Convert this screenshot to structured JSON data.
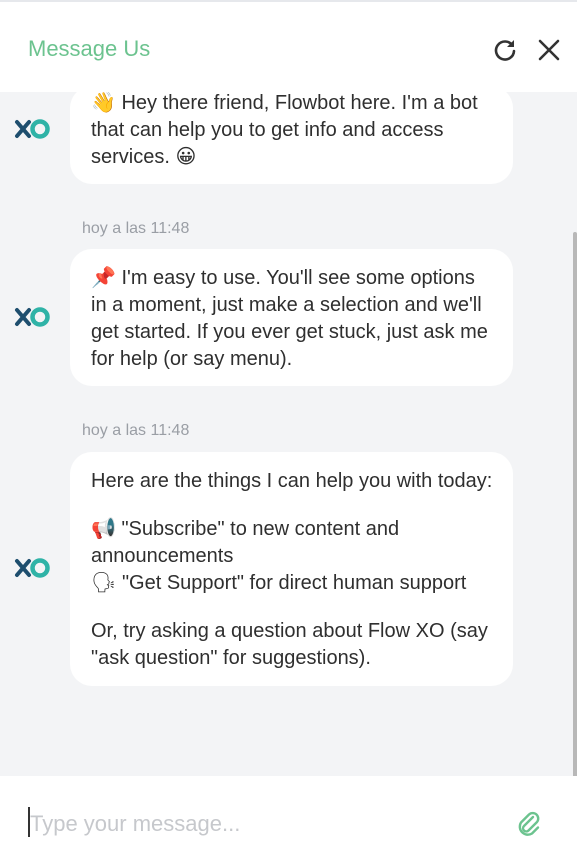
{
  "header": {
    "title": "Message Us"
  },
  "messages": [
    {
      "text": "👋 Hey there friend, Flowbot here. I'm a bot that can help you to get info and access services. 😀"
    },
    {
      "timestamp": "hoy a las 11:48",
      "text": "📌 I'm easy to use. You'll see some options in a moment, just make a selection and we'll get started. If you ever get stuck, just ask me for help (or say menu)."
    },
    {
      "timestamp": "hoy a las 11:48",
      "intro": "Here are the things I can help you with today:",
      "option1": "📢 \"Subscribe\" to new content and announcements",
      "option2": "🗣 \"Get Support\" for direct human support",
      "outro": "Or, try asking a question about Flow XO (say \"ask question\" for suggestions)."
    }
  ],
  "composer": {
    "placeholder": "Type your message..."
  },
  "colors": {
    "accent": "#6cc38f",
    "avatar_dark": "#1e4e6e",
    "avatar_teal": "#2fb3a7"
  },
  "icons": [
    "refresh-icon",
    "close-icon",
    "flowxo-avatar",
    "paperclip-icon"
  ]
}
